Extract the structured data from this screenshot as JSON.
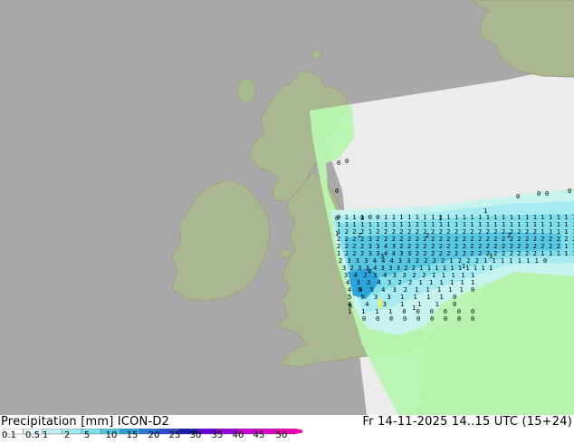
{
  "map": {
    "colors": {
      "sea": "#a9a9a9",
      "land": "#aab891",
      "land_shadow": "#8f9a79",
      "nodata": "#ececec",
      "coast": "#9aa182"
    },
    "labels": [
      {
        "v": "0"
      },
      {
        "v": "0"
      },
      {
        "v": "0"
      },
      {
        "v": "0"
      },
      {
        "v": "0"
      },
      {
        "v": "0"
      },
      {
        "v": "0"
      },
      {
        "v": "0"
      },
      {
        "v": "0"
      },
      {
        "v": "1"
      },
      {
        "v": "1"
      },
      {
        "v": "1"
      },
      {
        "v": "1"
      },
      {
        "v": "1"
      },
      {
        "v": "2"
      },
      {
        "v": "2"
      },
      {
        "v": "2"
      },
      {
        "v": "3"
      },
      {
        "v": "3"
      },
      {
        "v": "4"
      },
      {
        "v": "5"
      },
      {
        "v": "6"
      }
    ]
  },
  "footer": {
    "title": "Precipitation [mm]  ICON-D2",
    "datetime": "Fr 14-11-2025 14..15 UTC (15+24)",
    "scale_colors": [
      "#ffffff",
      "#e8f7f8",
      "#bfeff4",
      "#9eeaf1",
      "#7edde9",
      "#54c6e2",
      "#2aa4dc",
      "#2b78d9",
      "#2a4dd3",
      "#1c1cae",
      "#6a00d8",
      "#9a00dc",
      "#c800d6",
      "#de00c8",
      "#f000b4"
    ],
    "scale_ticks": [
      "0.1",
      "0.5",
      "1",
      "2",
      "5",
      "10",
      "15",
      "20",
      "25",
      "30",
      "35",
      "40",
      "45",
      "50"
    ]
  }
}
